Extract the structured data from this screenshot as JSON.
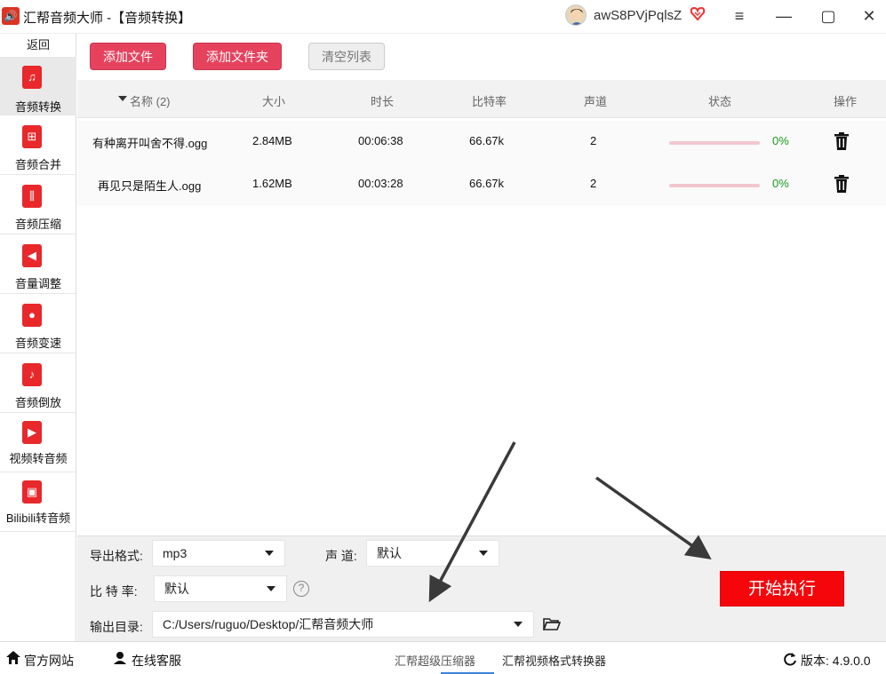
{
  "window": {
    "app_logo_glyph": "🔊",
    "title": "汇帮音频大师  -【音频转换】",
    "user_name": "awS8PVjPqlsZ",
    "minimize_glyph": "—",
    "menu_glyph": "≡",
    "maximize_glyph": "▢",
    "close_glyph": "✕"
  },
  "sidebar": {
    "back_label": "返回",
    "items": [
      {
        "label": "音频转换",
        "icon": "music-convert-icon",
        "glyph": "♫"
      },
      {
        "label": "音频合并",
        "icon": "merge-icon",
        "glyph": "⊞"
      },
      {
        "label": "音频压缩",
        "icon": "compress-icon",
        "glyph": "⫼"
      },
      {
        "label": "音量调整",
        "icon": "volume-icon",
        "glyph": "◀"
      },
      {
        "label": "音频变速",
        "icon": "microphone-icon",
        "glyph": "●"
      },
      {
        "label": "音频倒放",
        "icon": "music-note-icon",
        "glyph": "♪"
      },
      {
        "label": "视频转音频",
        "icon": "video-icon",
        "glyph": "▶"
      },
      {
        "label": "Bilibili转音频",
        "icon": "tv-icon",
        "glyph": "▣"
      }
    ]
  },
  "toolbar": {
    "add_file": "添加文件",
    "add_folder": "添加文件夹",
    "clear_list": "清空列表"
  },
  "table": {
    "headers": {
      "name": "名称 (2)",
      "size": "大小",
      "duration": "时长",
      "bitrate": "比特率",
      "channels": "声道",
      "status": "状态",
      "actions": "操作"
    },
    "rows": [
      {
        "name": "有种离开叫舍不得.ogg",
        "size": "2.84MB",
        "duration": "00:06:38",
        "bitrate": "66.67k",
        "channels": "2",
        "progress_pct": 0,
        "progress": "0%"
      },
      {
        "name": "再见只是陌生人.ogg",
        "size": "1.62MB",
        "duration": "00:03:28",
        "bitrate": "66.67k",
        "channels": "2",
        "progress_pct": 0,
        "progress": "0%"
      }
    ]
  },
  "settings": {
    "format_label": "导出格式:",
    "format_value": "mp3",
    "channel_label": "声  道:",
    "channel_value": "默认",
    "bitrate_label": "比 特 率:",
    "bitrate_value": "默认",
    "output_label": "输出目录:",
    "output_value": "C:/Users/ruguo/Desktop/汇帮音频大师",
    "help_glyph": "?"
  },
  "start_button": "开始执行",
  "footer": {
    "website": "官方网站",
    "support": "在线客服",
    "link1": "汇帮超级压缩器",
    "link2": "汇帮视频格式转换器",
    "version": "版本:  4.9.0.0"
  },
  "colors": {
    "accent": "#e6425e",
    "start": "#f4060b",
    "success": "#1a9a1a"
  }
}
